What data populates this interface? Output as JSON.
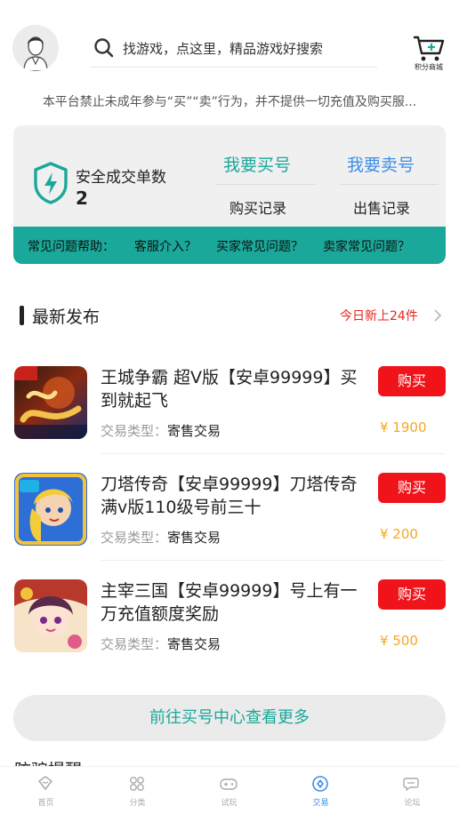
{
  "header": {
    "search_placeholder": "找游戏，点这里，精品游戏好搜索",
    "shop_label": "积分商城"
  },
  "notice": "本平台禁止未成年参与“买”“卖”行为，并不提供一切充值及购买服...",
  "card": {
    "safe_title": "安全成交单数",
    "safe_count": "2",
    "buy_tab": "我要买号",
    "sell_tab": "我要卖号",
    "buy_records": "购买记录",
    "sell_records": "出售记录",
    "faq_label": "常见问题帮助：",
    "faq_links": [
      "客服介入？",
      "买家常见问题？",
      "卖家常见问题？"
    ]
  },
  "section": {
    "title": "最新发布",
    "today_new": "今日新上24件"
  },
  "listings": [
    {
      "title": "王城争霸 超V版【安卓99999】买到就起飞",
      "type_label": "交易类型：",
      "type_value": "寄售交易",
      "buy_label": "购买",
      "price": "¥ 1900"
    },
    {
      "title": "刀塔传奇【安卓99999】刀塔传奇满v版110级号前三十",
      "type_label": "交易类型：",
      "type_value": "寄售交易",
      "buy_label": "购买",
      "price": "¥ 200"
    },
    {
      "title": "主宰三国【安卓99999】号上有一万充值额度奖励",
      "type_label": "交易类型：",
      "type_value": "寄售交易",
      "buy_label": "购买",
      "price": "¥ 500"
    }
  ],
  "more_button": "前往买号中心查看更多",
  "next_section_peek": "防骗提醒",
  "nav": {
    "tabs": [
      {
        "label": "首页",
        "icon": "home-icon"
      },
      {
        "label": "分类",
        "icon": "category-icon"
      },
      {
        "label": "试玩",
        "icon": "gamepad-icon"
      },
      {
        "label": "交易",
        "icon": "trade-icon"
      },
      {
        "label": "论坛",
        "icon": "forum-icon"
      }
    ],
    "active": "交易"
  },
  "colors": {
    "teal": "#1aa89a",
    "blue": "#3d8ee8",
    "red": "#f0141a",
    "price": "#f5a623"
  }
}
